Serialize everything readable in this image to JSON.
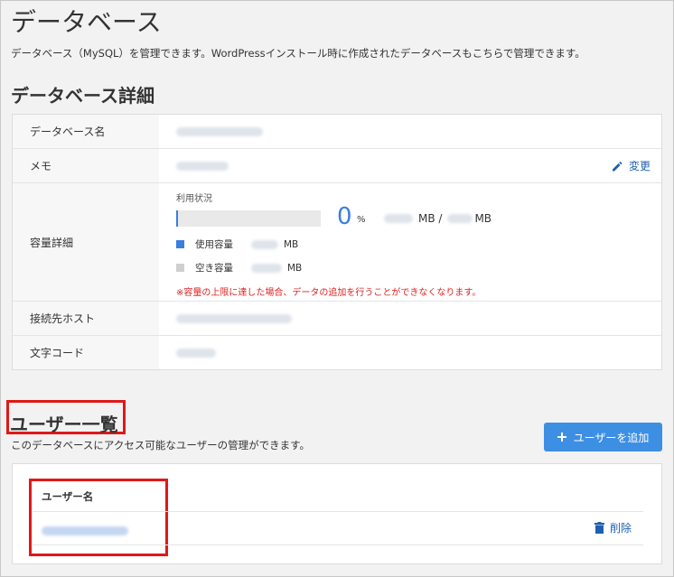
{
  "page": {
    "title": "データベース",
    "description": "データベース（MySQL）を管理できます。WordPressインストール時に作成されたデータベースもこちらで管理できます。"
  },
  "details": {
    "section_title": "データベース詳細",
    "db_name_label": "データベース名",
    "memo_label": "メモ",
    "edit_label": "変更",
    "capacity_label": "容量詳細",
    "usage_title": "利用状況",
    "usage_percent": "0",
    "usage_percent_unit": "%",
    "usage_unit_used": "MB /",
    "usage_unit_total": "MB",
    "legend_used": "使用容量",
    "legend_free": "空き容量",
    "legend_unit": "MB",
    "warning": "※容量の上限に達した場合、データの追加を行うことができなくなります。",
    "host_label": "接続先ホスト",
    "charset_label": "文字コード",
    "usage_fraction": 0.0,
    "colors": {
      "used": "#3b7de0",
      "free": "#cfcfcf",
      "warning": "#e02020"
    }
  },
  "users": {
    "section_title": "ユーザー一覧",
    "description": "このデータベースにアクセス可能なユーザーの管理ができます。",
    "add_button_label": "ユーザーを追加",
    "column_header": "ユーザー名",
    "delete_label": "削除"
  },
  "icons": {
    "edit": "pencil-icon",
    "add": "plus-icon",
    "delete": "trash-icon"
  }
}
